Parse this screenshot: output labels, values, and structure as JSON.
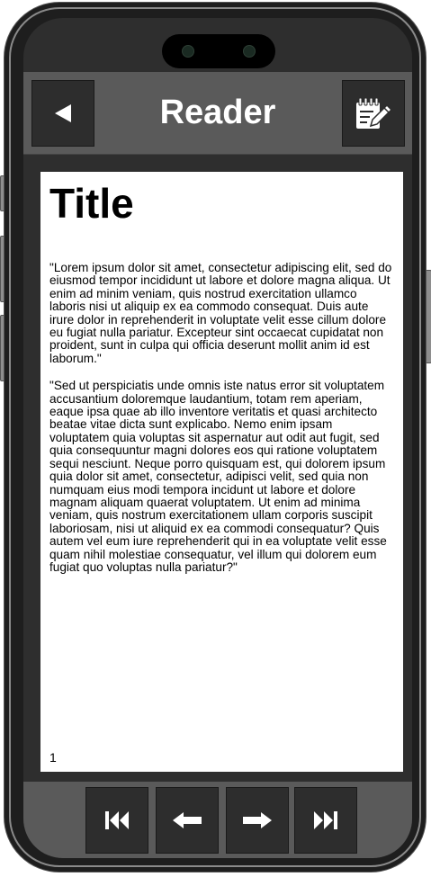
{
  "header": {
    "title": "Reader",
    "back_icon": "play-left-icon",
    "edit_icon": "edit-notepad-icon"
  },
  "document": {
    "title": "Title",
    "paragraphs": [
      "\"Lorem ipsum dolor sit amet, consectetur adipiscing elit, sed do eiusmod tempor incididunt ut labore et dolore magna aliqua. Ut enim ad minim veniam, quis nostrud exercitation ullamco laboris nisi ut aliquip ex ea commodo consequat. Duis aute irure dolor in reprehenderit in voluptate velit esse cillum dolore eu fugiat nulla pariatur. Excepteur sint occaecat cupidatat non proident, sunt in culpa qui officia deserunt mollit anim id est laborum.\"",
      "\"Sed ut perspiciatis unde omnis iste natus error sit voluptatem accusantium doloremque laudantium, totam rem aperiam, eaque ipsa quae ab illo inventore veritatis et quasi architecto beatae vitae dicta sunt explicabo. Nemo enim ipsam voluptatem quia voluptas sit aspernatur aut odit aut fugit, sed quia consequuntur magni dolores eos qui ratione voluptatem sequi nesciunt. Neque porro quisquam est, qui dolorem ipsum quia dolor sit amet, consectetur, adipisci velit, sed quia non numquam eius modi tempora incidunt ut labore et dolore magnam aliquam quaerat voluptatem. Ut enim ad minima veniam, quis nostrum exercitationem ullam corporis suscipit laboriosam, nisi ut aliquid ex ea commodi consequatur? Quis autem vel eum iure reprehenderit qui in ea voluptate velit esse quam nihil molestiae consequatur, vel illum qui dolorem eum fugiat quo voluptas nulla pariatur?\""
    ],
    "page_number": "1"
  },
  "footer": {
    "buttons": [
      "first-page-icon",
      "previous-page-icon",
      "next-page-icon",
      "last-page-icon"
    ]
  },
  "colors": {
    "phone_body": "#1e1e1e",
    "bar": "#5a5a5a",
    "button": "#2d2d2d",
    "page": "#ffffff"
  }
}
